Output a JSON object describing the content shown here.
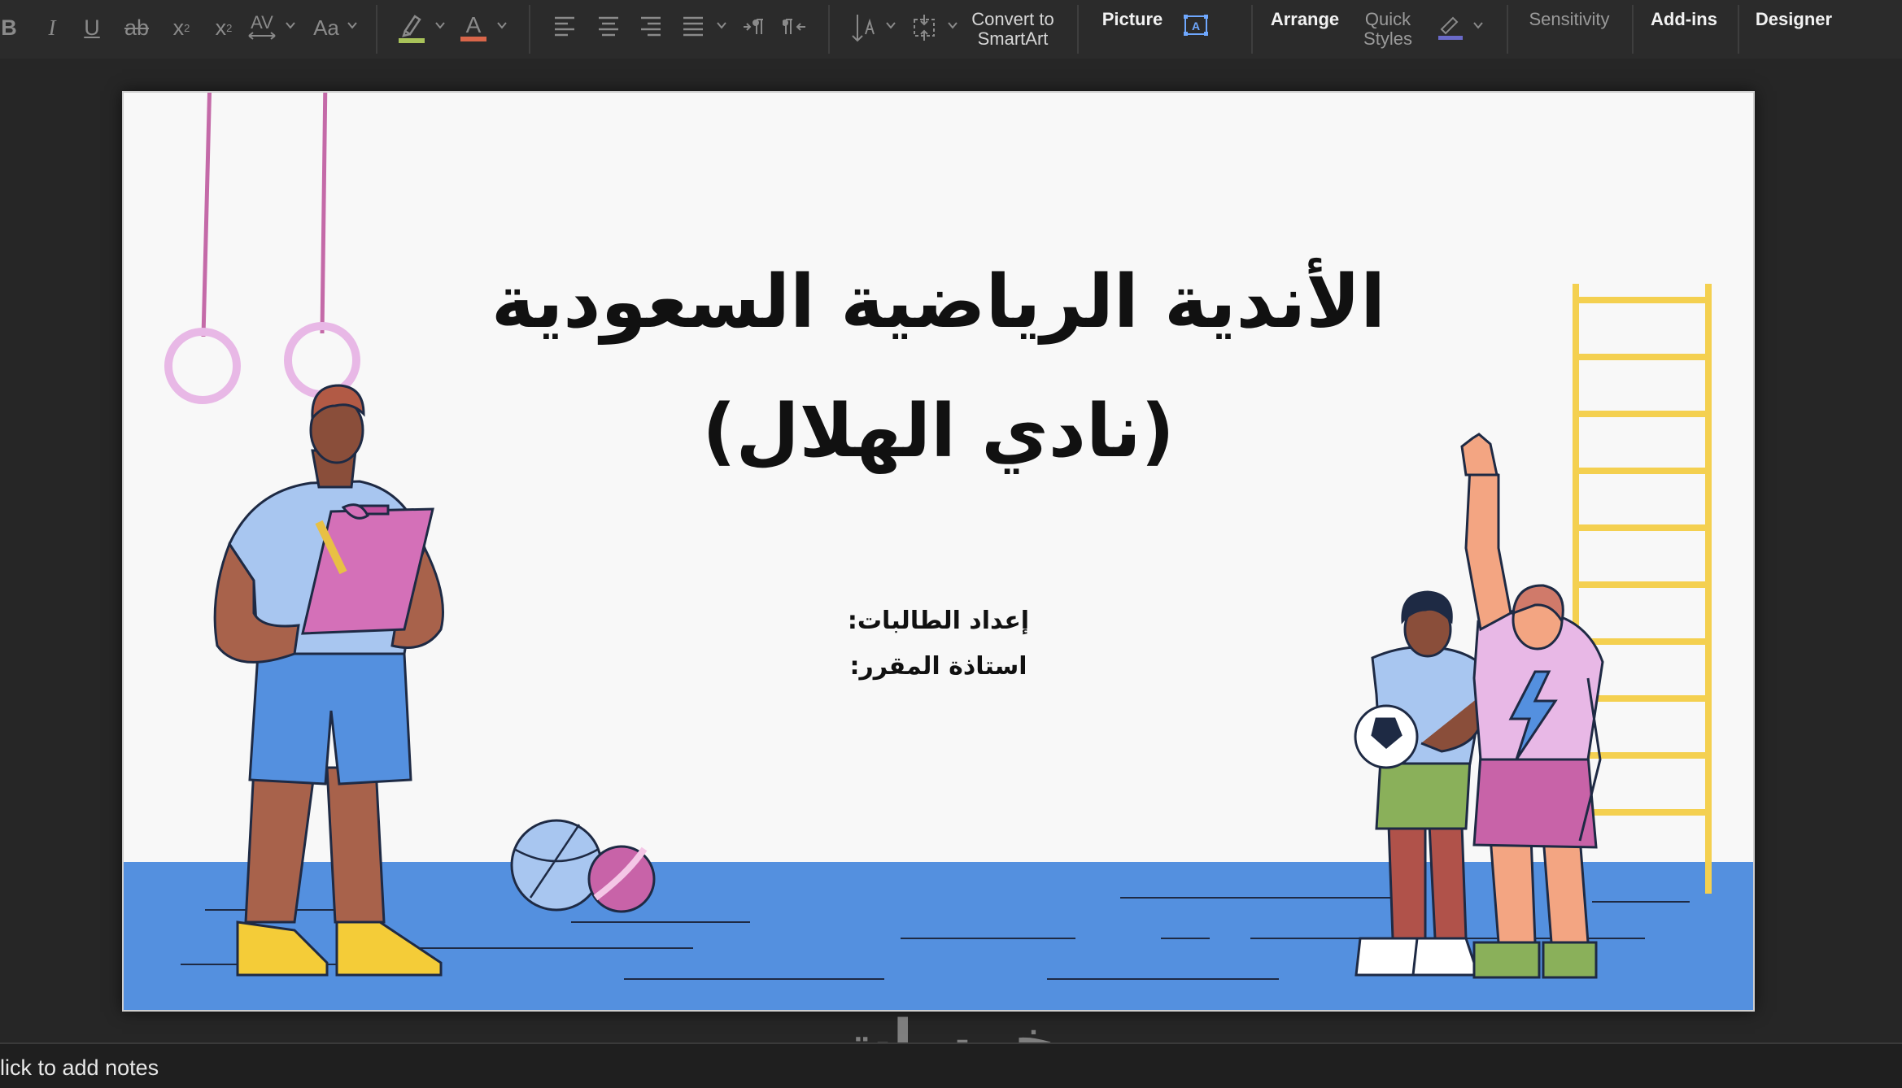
{
  "ribbon": {
    "format": {
      "bold": "B",
      "italic": "I",
      "underline": "U",
      "strikethrough": "ab",
      "superscript": "x",
      "superscript_mark": "2",
      "subscript": "x",
      "subscript_mark": "2",
      "char_spacing": "AV",
      "change_case": "Aa",
      "font_color_letter": "A"
    },
    "convert_smartart": [
      "Convert to",
      "SmartArt"
    ],
    "picture": "Picture",
    "arrange": "Arrange",
    "quick_styles": [
      "Quick",
      "Styles"
    ],
    "sensitivity": "Sensitivity",
    "addins": "Add-ins",
    "designer": "Designer"
  },
  "colors": {
    "highlight": "#a9c35a",
    "font_color": "#d9664a",
    "floor": "#5490df",
    "ladder": "#f4d050",
    "rings": "#e8b8e6",
    "ropes": "#c46aa8"
  },
  "slide": {
    "title_line1": "الأندية الرياضية السعودية",
    "title_line2": "(نادي الهلال)",
    "prepared_by": "إعداد الطالبات:",
    "instructor": "استاذة المقرر:"
  },
  "notes": {
    "placeholder": "lick to add notes"
  },
  "watermark": "خمسات"
}
